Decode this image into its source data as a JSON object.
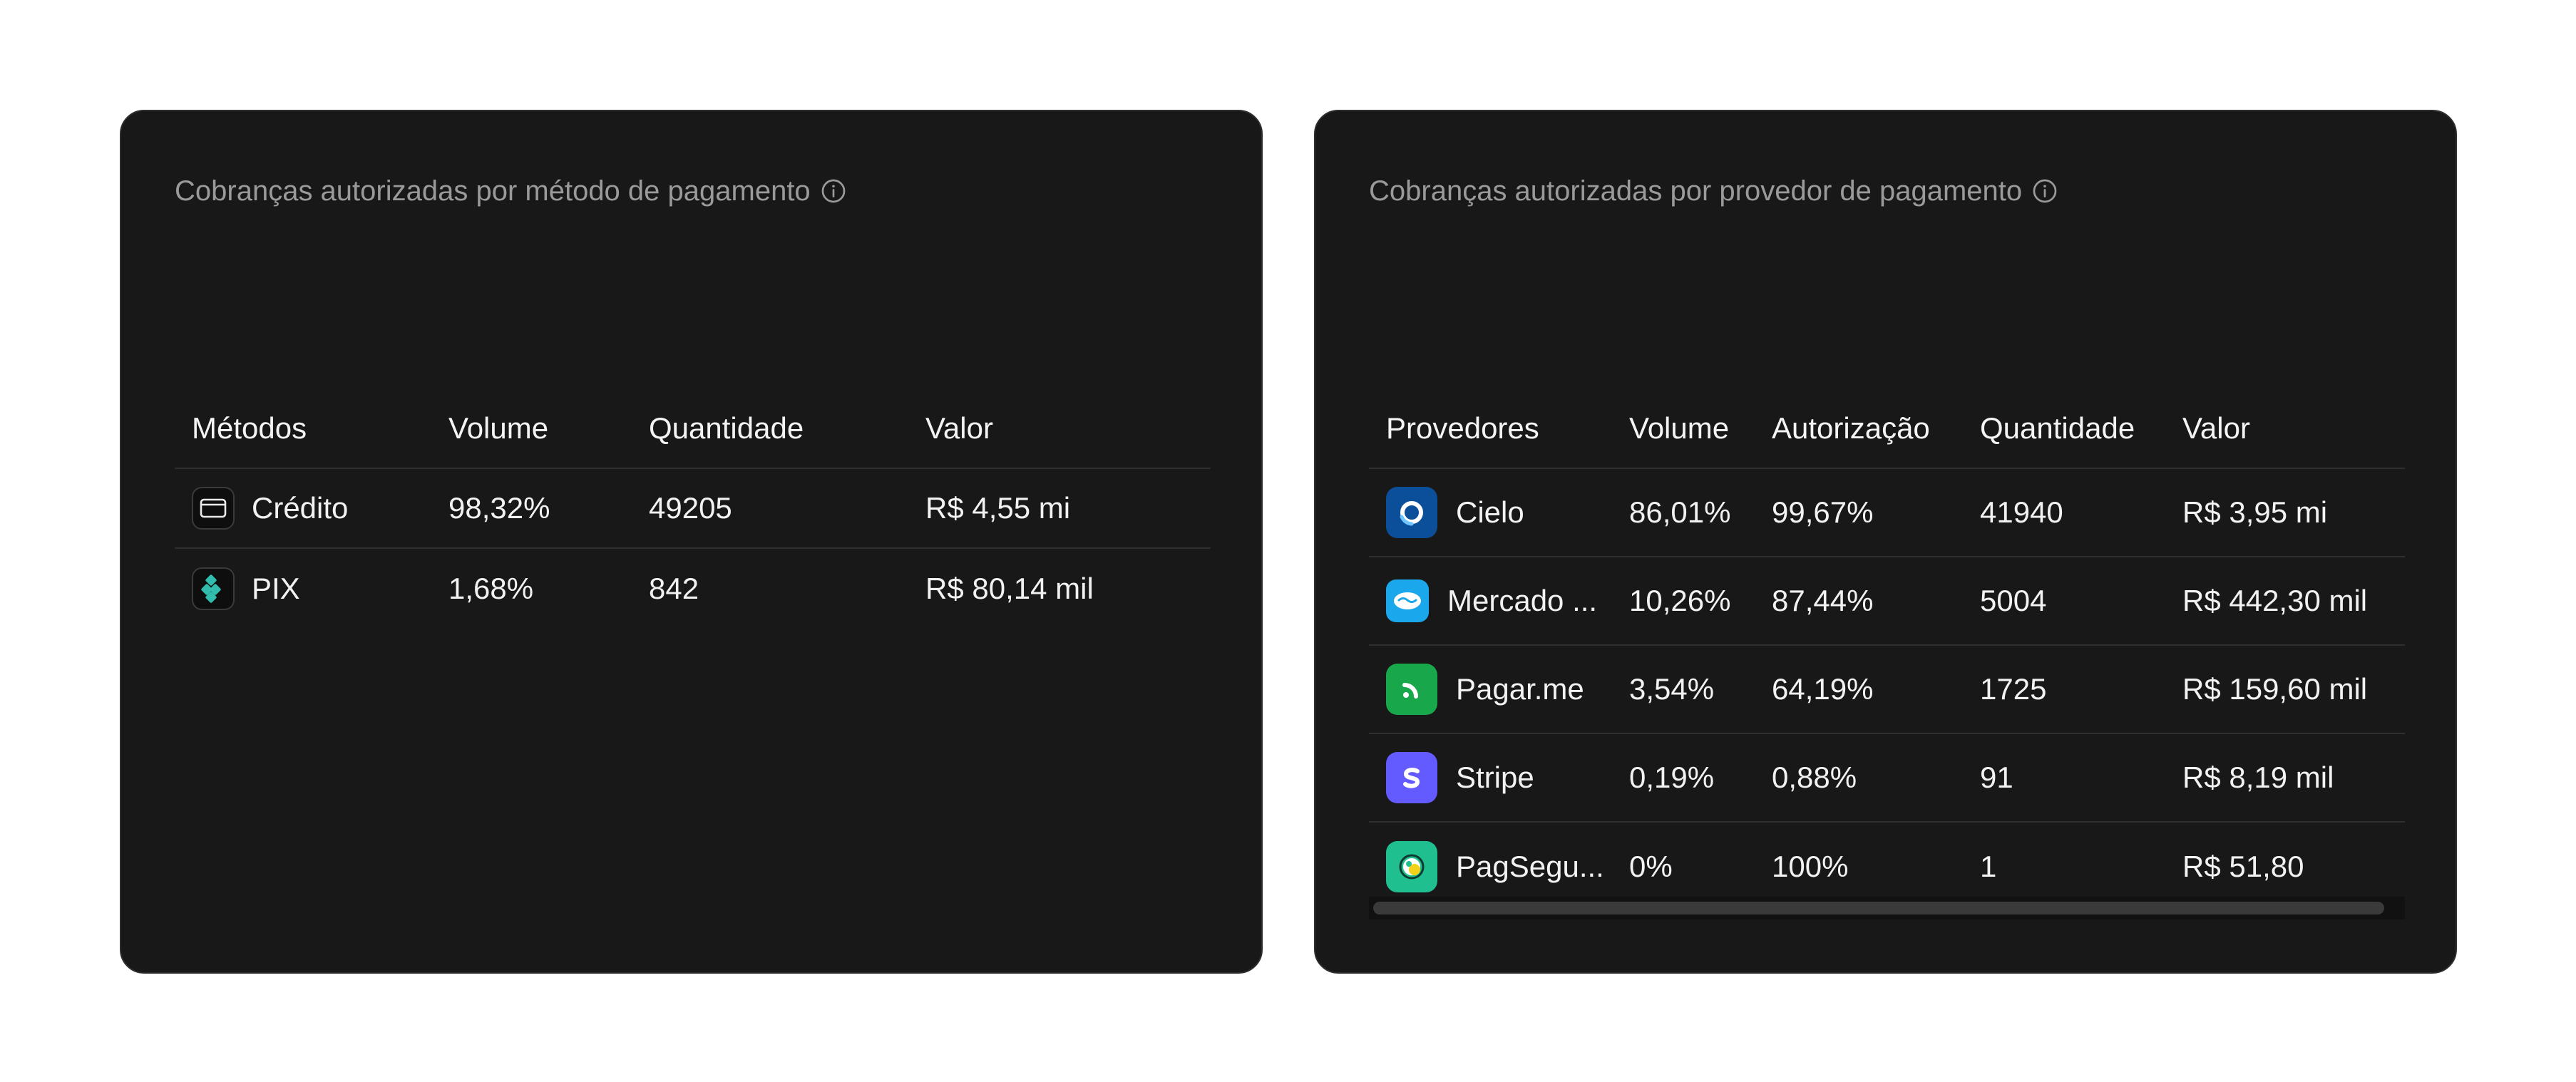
{
  "methods_card": {
    "title": "Cobranças autorizadas por método de pagamento",
    "columns": [
      "Métodos",
      "Volume",
      "Quantidade",
      "Valor"
    ],
    "rows": [
      {
        "icon": "credit-card-icon",
        "name": "Crédito",
        "volume": "98,32%",
        "quantity": "49205",
        "value": "R$ 4,55 mi"
      },
      {
        "icon": "pix-icon",
        "name": "PIX",
        "volume": "1,68%",
        "quantity": "842",
        "value": "R$ 80,14 mil"
      }
    ]
  },
  "providers_card": {
    "title": "Cobranças autorizadas por provedor de pagamento",
    "columns": [
      "Provedores",
      "Volume",
      "Autorização",
      "Quantidade",
      "Valor"
    ],
    "rows": [
      {
        "icon": "cielo-logo-icon",
        "name": "Cielo",
        "volume": "86,01%",
        "authorization": "99,67%",
        "quantity": "41940",
        "value": "R$ 3,95 mi"
      },
      {
        "icon": "mercado-pago-logo-icon",
        "name": "Mercado ...",
        "volume": "10,26%",
        "authorization": "87,44%",
        "quantity": "5004",
        "value": "R$ 442,30 mil"
      },
      {
        "icon": "pagarme-logo-icon",
        "name": "Pagar.me",
        "volume": "3,54%",
        "authorization": "64,19%",
        "quantity": "1725",
        "value": "R$ 159,60 mil"
      },
      {
        "icon": "stripe-logo-icon",
        "name": "Stripe",
        "volume": "0,19%",
        "authorization": "0,88%",
        "quantity": "91",
        "value": "R$ 8,19 mil"
      },
      {
        "icon": "pagseguro-logo-icon",
        "name": "PagSegu...",
        "volume": "0%",
        "authorization": "100%",
        "quantity": "1",
        "value": "R$ 51,80"
      }
    ]
  },
  "colors": {
    "card_bg": "#181818",
    "card_border": "#2e2e2e",
    "title_text": "#9a9a9a",
    "cell_text": "#f2f2f2",
    "row_divider": "#2f2f2f",
    "cielo": "#0b4e9a",
    "mercado_pago": "#1aa7ec",
    "pagarme": "#18a74a",
    "stripe": "#635bff",
    "pagseguro": "#1fbf8f",
    "pix": "#32bcad"
  }
}
